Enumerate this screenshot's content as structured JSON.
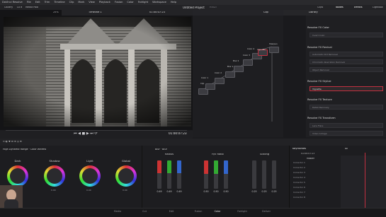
{
  "menubar": {
    "items": [
      "DaVinci Resolve",
      "File",
      "Edit",
      "Trim",
      "Timeline",
      "Clip",
      "Mark",
      "View",
      "Playback",
      "Fusion",
      "Color",
      "Fairlight",
      "Workspace",
      "Help"
    ]
  },
  "toolbar": {
    "title": "Untitled Project",
    "edited": "Edited",
    "gallery": "Gallery",
    "luts": "LUTs",
    "media_pool": "Media Pool",
    "clips": "Clips",
    "nodes": "Nodes",
    "effects": "Effects",
    "lightbox": "Lightbox"
  },
  "viewer": {
    "zoom": "25%",
    "timeline": "Timeline 1",
    "timecode_top": "01:00:07:23",
    "timecode": "01:00:07:23"
  },
  "node_editor": {
    "label": "Clip",
    "nodes": [
      {
        "id": "01",
        "name": "Clip"
      },
      {
        "id": "02",
        "name": "Color 1"
      },
      {
        "id": "03",
        "name": "Color 2"
      },
      {
        "id": "04",
        "name": "Blur 1"
      },
      {
        "id": "05",
        "name": "Blur 2"
      },
      {
        "id": "06",
        "name": "Color 3"
      },
      {
        "id": "07",
        "name": "Color 4"
      },
      {
        "id": "08",
        "name": "Vignette"
      },
      {
        "id": "09",
        "name": "Sharpen"
      }
    ]
  },
  "library": {
    "tab": "Library",
    "sections": [
      {
        "title": "Resolve FX Color",
        "items": [
          "Invert Color"
        ]
      },
      {
        "title": "Resolve FX Revival",
        "items": [
          "Automatic Dirt Removal",
          "Chromatic Aberration Removal",
          "Object Removal"
        ]
      },
      {
        "title": "Resolve FX Stylize",
        "items": [
          "Vignette"
        ]
      },
      {
        "title": "Resolve FX Texture",
        "items": [
          "Detail Recovery"
        ]
      },
      {
        "title": "Resolve FX Transform",
        "items": [
          "Lens Flare",
          "Video Collage"
        ]
      }
    ]
  },
  "wheels": {
    "mode": "High Dynamic Range · Color Wheels",
    "labels": [
      "Dark",
      "Shadow",
      "Light",
      "Global"
    ],
    "value": "0.00"
  },
  "bars": {
    "mode": "Blur · Blur",
    "groups": [
      "Radius",
      "H/V Ratio",
      "Scaling"
    ],
    "values": [
      "0.49",
      "0.49",
      "0.49",
      "0.50",
      "0.50",
      "0.50",
      "0.25",
      "0.25",
      "0.25"
    ]
  },
  "keyframes": {
    "title": "Keyframes",
    "timecode": "01:00:07:23",
    "master": "Master",
    "rows": [
      "Corrector 1",
      "Corrector 2",
      "Corrector 3",
      "Corrector 4",
      "Corrector 5",
      "Corrector 6",
      "Corrector 7",
      "Corrector 8"
    ],
    "filter": "All"
  },
  "pages": [
    "Media",
    "Cut",
    "Edit",
    "Fusion",
    "Color",
    "Fairlight",
    "Deliver"
  ],
  "colors": {
    "accent": "#c23040",
    "selected_tab": "#e8e8e8"
  }
}
